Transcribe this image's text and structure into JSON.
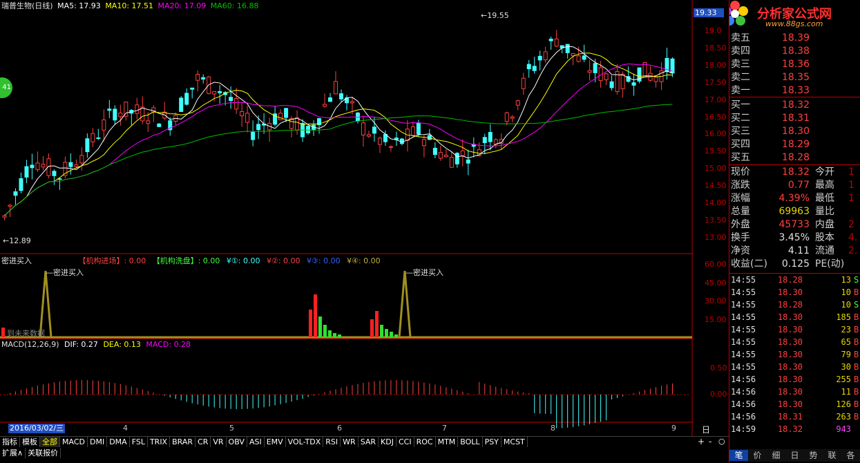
{
  "main_header": {
    "stock": "瑞普生物(日线)",
    "ma5": "MA5: 17.93",
    "ma10": "MA10: 17.51",
    "ma20": "MA20: 17.09",
    "ma60": "MA60: 16.88"
  },
  "price_axis": [
    "19.0",
    "18.50",
    "18.00",
    "17.50",
    "17.00",
    "16.50",
    "16.00",
    "15.50",
    "15.00",
    "14.50",
    "14.00",
    "13.50",
    "13.00"
  ],
  "price_axis_current": "19.33",
  "high_annot": "19.55",
  "low_annot": "12.89",
  "side_badge": "41",
  "indicator_panel": {
    "title": "密进买入",
    "inst_in": "【机构进场】: 0.00",
    "inst_wash": "【机构洗盘】: 0.00",
    "y1": "¥①: 0.00",
    "y2": "¥②: 0.00",
    "y3": "¥③: 0.00",
    "y4": "¥④: 0.00",
    "signal_label_1": "密进买入",
    "signal_label_2": "密进买入",
    "watermark": "到未来数据",
    "axis": [
      "60.00",
      "45.00",
      "30.00",
      "15.00"
    ]
  },
  "macd_panel": {
    "title": "MACD(12,26,9)",
    "dif": "DIF: 0.27",
    "dea": "DEA: 0.13",
    "macd": "MACD: 0.28",
    "axis": [
      "0.50",
      "0.00"
    ]
  },
  "date_axis": {
    "selected": "2016/03/02/三",
    "months": [
      "4",
      "5",
      "6",
      "7",
      "8",
      "9"
    ],
    "period": "日线"
  },
  "tabs": [
    "指标",
    "模板",
    "全部",
    "MACD",
    "DMI",
    "DMA",
    "FSL",
    "TRIX",
    "BRAR",
    "CR",
    "VR",
    "OBV",
    "ASI",
    "EMV",
    "VOL-TDX",
    "RSI",
    "WR",
    "SAR",
    "KDJ",
    "CCI",
    "ROC",
    "MTM",
    "BOLL",
    "PSY",
    "MCST"
  ],
  "tabs2": [
    "扩展∧",
    "关联报价"
  ],
  "zoom_plus": "+",
  "zoom_minus": "-",
  "zoom_fit": "○",
  "logo": {
    "title": "分析家公式网",
    "url": "www.88gs.com"
  },
  "order_book": {
    "sell": [
      {
        "label": "卖五",
        "price": "18.39"
      },
      {
        "label": "卖四",
        "price": "18.38"
      },
      {
        "label": "卖三",
        "price": "18.36"
      },
      {
        "label": "卖二",
        "price": "18.35"
      },
      {
        "label": "卖一",
        "price": "18.33"
      }
    ],
    "buy": [
      {
        "label": "买一",
        "price": "18.32"
      },
      {
        "label": "买二",
        "price": "18.31"
      },
      {
        "label": "买三",
        "price": "18.30"
      },
      {
        "label": "买四",
        "price": "18.29"
      },
      {
        "label": "买五",
        "price": "18.28"
      }
    ]
  },
  "stats": [
    {
      "l1": "现价",
      "v1": "18.32",
      "l2": "今开",
      "v2": "1",
      "c1": "#ff4040"
    },
    {
      "l1": "涨跌",
      "v1": "0.77",
      "l2": "最高",
      "v2": "1",
      "c1": "#ff4040"
    },
    {
      "l1": "涨幅",
      "v1": "4.39%",
      "l2": "最低",
      "v2": "1",
      "c1": "#ff4040"
    },
    {
      "l1": "总量",
      "v1": "69963",
      "l2": "量比",
      "v2": "",
      "c1": "#e6d600"
    },
    {
      "l1": "外盘",
      "v1": "45733",
      "l2": "内盘",
      "v2": "2",
      "c1": "#ff4040"
    },
    {
      "l1": "换手",
      "v1": "3.45%",
      "l2": "股本",
      "v2": "4.",
      "c1": "#e0e0e0"
    },
    {
      "l1": "净资",
      "v1": "4.11",
      "l2": "流通",
      "v2": "2.",
      "c1": "#e0e0e0"
    },
    {
      "l1": "收益(二)",
      "v1": "0.125",
      "l2": "PE(动)",
      "v2": "",
      "c1": "#e0e0e0"
    }
  ],
  "ticks": [
    {
      "time": "14:55",
      "price": "18.28",
      "vol": "13",
      "bs": "S"
    },
    {
      "time": "14:55",
      "price": "18.30",
      "vol": "10",
      "bs": "B"
    },
    {
      "time": "14:55",
      "price": "18.28",
      "vol": "10",
      "bs": "S"
    },
    {
      "time": "14:55",
      "price": "18.30",
      "vol": "185",
      "bs": "B"
    },
    {
      "time": "14:55",
      "price": "18.30",
      "vol": "23",
      "bs": "B"
    },
    {
      "time": "14:55",
      "price": "18.30",
      "vol": "65",
      "bs": "B"
    },
    {
      "time": "14:55",
      "price": "18.30",
      "vol": "79",
      "bs": "B"
    },
    {
      "time": "14:55",
      "price": "18.30",
      "vol": "30",
      "bs": "B"
    },
    {
      "time": "14:56",
      "price": "18.30",
      "vol": "255",
      "bs": "B"
    },
    {
      "time": "14:56",
      "price": "18.30",
      "vol": "11",
      "bs": "B"
    },
    {
      "time": "14:56",
      "price": "18.30",
      "vol": "126",
      "bs": "B"
    },
    {
      "time": "14:56",
      "price": "18.31",
      "vol": "263",
      "bs": "B"
    },
    {
      "time": "14:59",
      "price": "18.32",
      "vol": "943",
      "bs": ""
    }
  ],
  "bottom_tabs": [
    "笔",
    "价",
    "细",
    "日",
    "势",
    "联",
    "各"
  ],
  "colors": {
    "up": "#ff4040",
    "down": "#40ffff",
    "ma5": "#ffffff",
    "ma10": "#ffff00",
    "ma20": "#ff00ff",
    "ma60": "#00c000",
    "frame": "#c00000"
  }
}
